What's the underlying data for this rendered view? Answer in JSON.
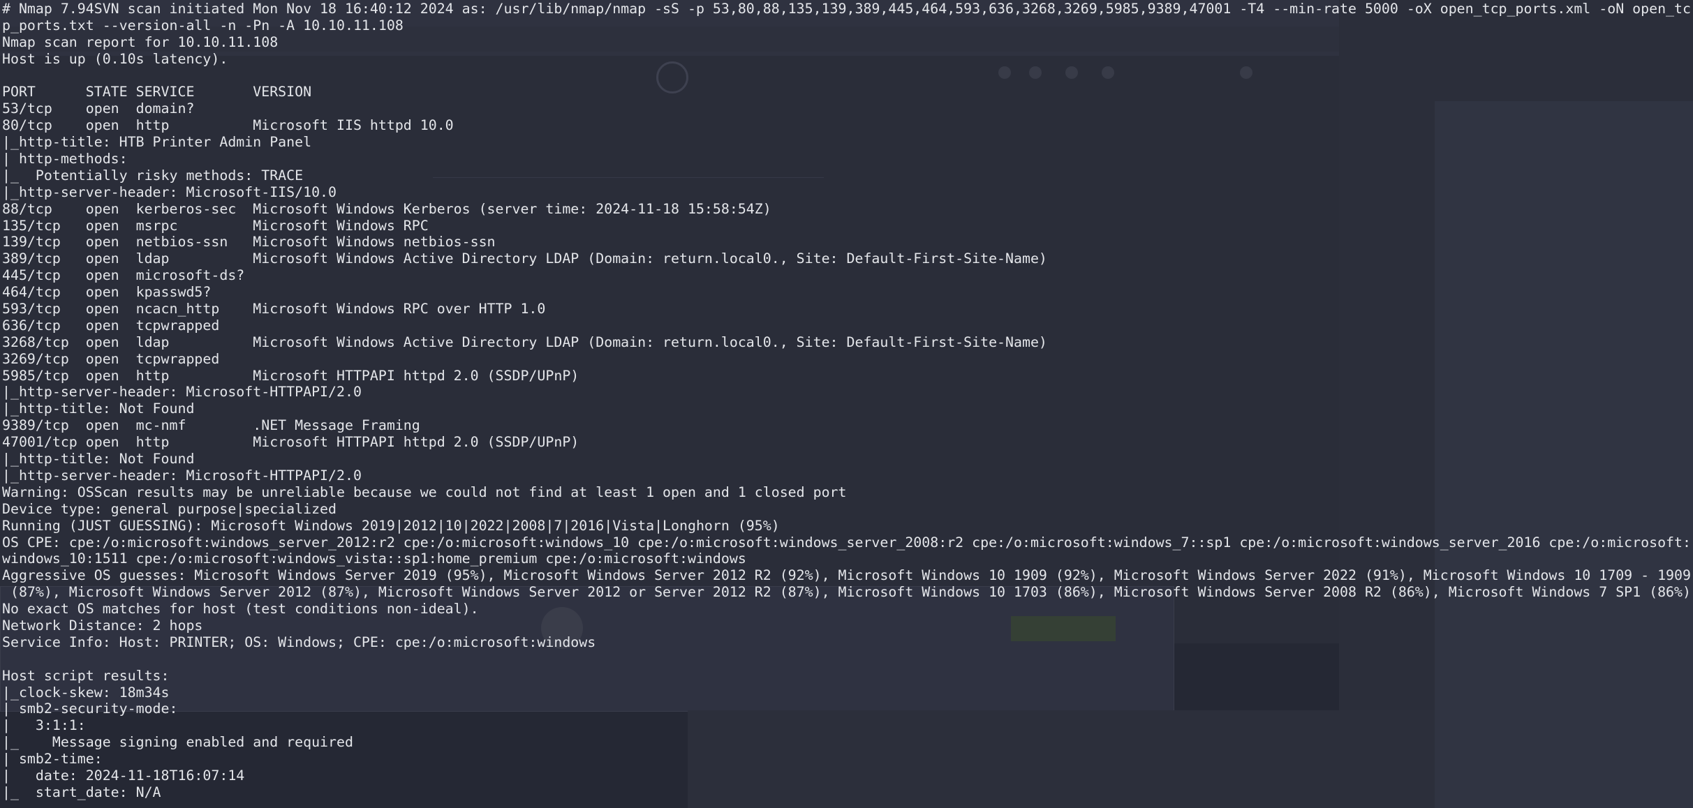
{
  "terminal": {
    "lines": [
      "# Nmap 7.94SVN scan initiated Mon Nov 18 16:40:12 2024 as: /usr/lib/nmap/nmap -sS -p 53,80,88,135,139,389,445,464,593,636,3268,3269,5985,9389,47001 -T4 --min-rate 5000 -oX open_tcp_ports.xml -oN open_tc",
      "p_ports.txt --version-all -n -Pn -A 10.10.11.108",
      "Nmap scan report for 10.10.11.108",
      "Host is up (0.10s latency).",
      "",
      "PORT      STATE SERVICE       VERSION",
      "53/tcp    open  domain?",
      "80/tcp    open  http          Microsoft IIS httpd 10.0",
      "|_http-title: HTB Printer Admin Panel",
      "| http-methods:",
      "|_  Potentially risky methods: TRACE",
      "|_http-server-header: Microsoft-IIS/10.0",
      "88/tcp    open  kerberos-sec  Microsoft Windows Kerberos (server time: 2024-11-18 15:58:54Z)",
      "135/tcp   open  msrpc         Microsoft Windows RPC",
      "139/tcp   open  netbios-ssn   Microsoft Windows netbios-ssn",
      "389/tcp   open  ldap          Microsoft Windows Active Directory LDAP (Domain: return.local0., Site: Default-First-Site-Name)",
      "445/tcp   open  microsoft-ds?",
      "464/tcp   open  kpasswd5?",
      "593/tcp   open  ncacn_http    Microsoft Windows RPC over HTTP 1.0",
      "636/tcp   open  tcpwrapped",
      "3268/tcp  open  ldap          Microsoft Windows Active Directory LDAP (Domain: return.local0., Site: Default-First-Site-Name)",
      "3269/tcp  open  tcpwrapped",
      "5985/tcp  open  http          Microsoft HTTPAPI httpd 2.0 (SSDP/UPnP)",
      "|_http-server-header: Microsoft-HTTPAPI/2.0",
      "|_http-title: Not Found",
      "9389/tcp  open  mc-nmf        .NET Message Framing",
      "47001/tcp open  http          Microsoft HTTPAPI httpd 2.0 (SSDP/UPnP)",
      "|_http-title: Not Found",
      "|_http-server-header: Microsoft-HTTPAPI/2.0",
      "Warning: OSScan results may be unreliable because we could not find at least 1 open and 1 closed port",
      "Device type: general purpose|specialized",
      "Running (JUST GUESSING): Microsoft Windows 2019|2012|10|2022|2008|7|2016|Vista|Longhorn (95%)",
      "OS CPE: cpe:/o:microsoft:windows_server_2012:r2 cpe:/o:microsoft:windows_10 cpe:/o:microsoft:windows_server_2008:r2 cpe:/o:microsoft:windows_7::sp1 cpe:/o:microsoft:windows_server_2016 cpe:/o:microsoft:",
      "windows_10:1511 cpe:/o:microsoft:windows_vista::sp1:home_premium cpe:/o:microsoft:windows",
      "Aggressive OS guesses: Microsoft Windows Server 2019 (95%), Microsoft Windows Server 2012 R2 (92%), Microsoft Windows 10 1909 (92%), Microsoft Windows Server 2022 (91%), Microsoft Windows 10 1709 - 1909",
      " (87%), Microsoft Windows Server 2012 (87%), Microsoft Windows Server 2012 or Server 2012 R2 (87%), Microsoft Windows 10 1703 (86%), Microsoft Windows Server 2008 R2 (86%), Microsoft Windows 7 SP1 (86%)",
      "No exact OS matches for host (test conditions non-ideal).",
      "Network Distance: 2 hops",
      "Service Info: Host: PRINTER; OS: Windows; CPE: cpe:/o:microsoft:windows",
      "",
      "Host script results:",
      "|_clock-skew: 18m34s",
      "| smb2-security-mode:",
      "|   3:1:1:",
      "|_    Message signing enabled and required",
      "| smb2-time:",
      "|   date: 2024-11-18T16:07:14",
      "|_  start_date: N/A"
    ]
  },
  "colors": {
    "terminal_text": "#e4e6ea",
    "terminal_background": "#252834"
  }
}
